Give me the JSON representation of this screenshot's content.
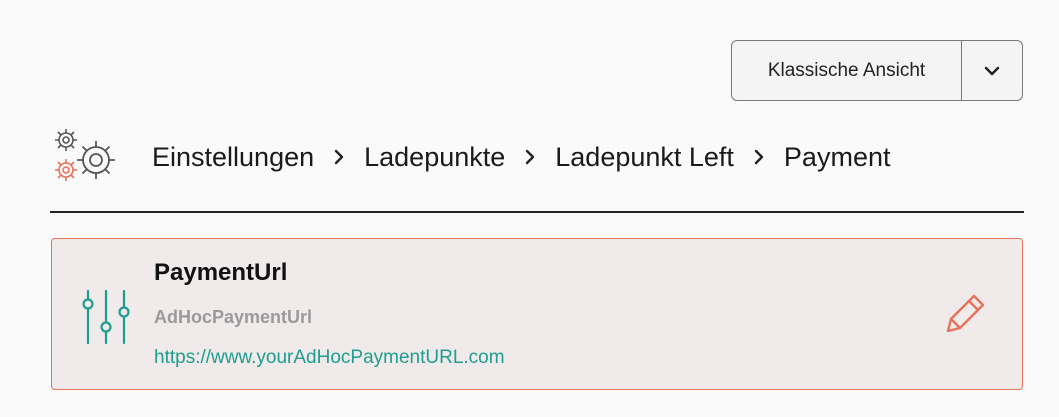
{
  "view_selector": {
    "label": "Klassische Ansicht",
    "toggle_icon": "chevron-down-icon"
  },
  "header": {
    "icon": "settings-gears-icon",
    "breadcrumb": [
      {
        "label": "Einstellungen"
      },
      {
        "label": "Ladepunkte"
      },
      {
        "label": "Ladepunkt Left"
      },
      {
        "label": "Payment"
      }
    ],
    "separator_icon": "chevron-right-icon"
  },
  "setting": {
    "icon": "sliders-icon",
    "title": "PaymentUrl",
    "key": "AdHocPaymentUrl",
    "value": "https://www.yourAdHocPaymentURL.com",
    "edit_icon": "pencil-icon"
  },
  "colors": {
    "accent": "#e5735a",
    "teal": "#1e9e8e",
    "card_background": "#f0eaea",
    "muted_text": "#9a9a9a"
  }
}
